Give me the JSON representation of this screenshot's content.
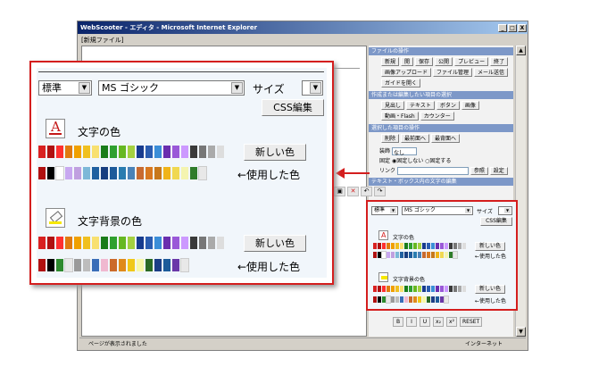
{
  "window": {
    "title": "WebScooter - エディタ - Microsoft Internet Explorer",
    "min": "_",
    "max": "□",
    "close": "X"
  },
  "menu": {
    "new_file": "[新規ファイル]"
  },
  "right_panel": {
    "file_ops": {
      "header": "ファイルの操作",
      "buttons": [
        "新規",
        "開",
        "保存",
        "公開",
        "プレビュー",
        "終了",
        "画像アップロード",
        "ファイル管理",
        "メール送信",
        "ガイドを開く"
      ]
    },
    "insert": {
      "header": "作成または編集したい項目の選択",
      "buttons": [
        "見出し",
        "テキスト",
        "ボタン",
        "画像",
        "動画・Flash",
        "カウンター"
      ]
    },
    "selected": {
      "header": "選択した項目の操作",
      "buttons": [
        "削除",
        "最前面へ",
        "最背面へ"
      ]
    },
    "props": {
      "link_label": "装飾",
      "link_value": "なし",
      "fixed_label": "固定",
      "fixed_opt1": "固定しない",
      "fixed_opt2": "固定する",
      "link2_label": "リンク",
      "ref_button": "参照",
      "set_button": "設定"
    },
    "text_header": "テキスト・ボックス内の文字の編集"
  },
  "editor": {
    "style_select": "標準",
    "font_select": "MS ゴシック",
    "size_label": "サイズ",
    "size_select": "",
    "css_button": "CSS編集",
    "text_color_label": "文字の色",
    "new_color_button": "新しい色",
    "used_colors_label": "←使用した色",
    "bg_color_label": "文字背景の色",
    "new_bg_button": "新しい色",
    "used_bg_label": "←使用した色"
  },
  "format_buttons": [
    "B",
    "I",
    "U",
    "x₂",
    "x²",
    "RESET"
  ],
  "status": {
    "text": "ページが表示されました",
    "zone": "インターネット"
  },
  "palettes": {
    "text_colors": [
      "#d92020",
      "#b01010",
      "#ff3030",
      "#e07a10",
      "#f0a000",
      "#f0c020",
      "#f8e070",
      "#1a7d1a",
      "#2fa02f",
      "#66b822",
      "#a4d040",
      "#173b8e",
      "#2a5cb0",
      "#3b8ed8",
      "#6a2eae",
      "#9a58d8",
      "#cc99ff",
      "#3a3a3a",
      "#777777",
      "#aaaaaa",
      "#dddddd"
    ],
    "text_used": [
      "#b01010",
      "#000000",
      "#ffffff",
      "#c8a8f0",
      "#c0a0e0",
      "#7db8d8",
      "#2060a0",
      "#183e80",
      "#1d5a9a",
      "#2a7cb0",
      "#4a82b8",
      "#c86a30",
      "#d87820",
      "#c8781a",
      "#f0b418",
      "#f0d850",
      "#f4f4b0",
      "#2f7c2a",
      "#e8e8e8"
    ],
    "bg_colors": [
      "#d92020",
      "#b01010",
      "#ff3030",
      "#e07a10",
      "#f0a000",
      "#f0c020",
      "#f8e070",
      "#1a7d1a",
      "#2fa02f",
      "#66b822",
      "#a4d040",
      "#173b8e",
      "#2a5cb0",
      "#3b8ed8",
      "#6a2eae",
      "#9a58d8",
      "#cc99ff",
      "#3a3a3a",
      "#777777",
      "#aaaaaa",
      "#dddddd"
    ],
    "bg_used": [
      "#b01010",
      "#000000",
      "#2e8a2e",
      "#e8e8e8",
      "#9a9a9a",
      "#bdbdbd",
      "#3a6eb8",
      "#f0b8d0",
      "#cb6a2a",
      "#e08a1a",
      "#f0c818",
      "#f8f8a8",
      "#2a6a24",
      "#1c3e86",
      "#1d5b9a",
      "#6a38a8",
      "#e8e8e8"
    ]
  },
  "icons": {
    "text_icon": "text-color-icon",
    "bg_icon": "highlighter-icon"
  },
  "colors": {
    "accent": "#d41e1e",
    "header": "#7d98c8",
    "titlebar": "#0a246a"
  }
}
